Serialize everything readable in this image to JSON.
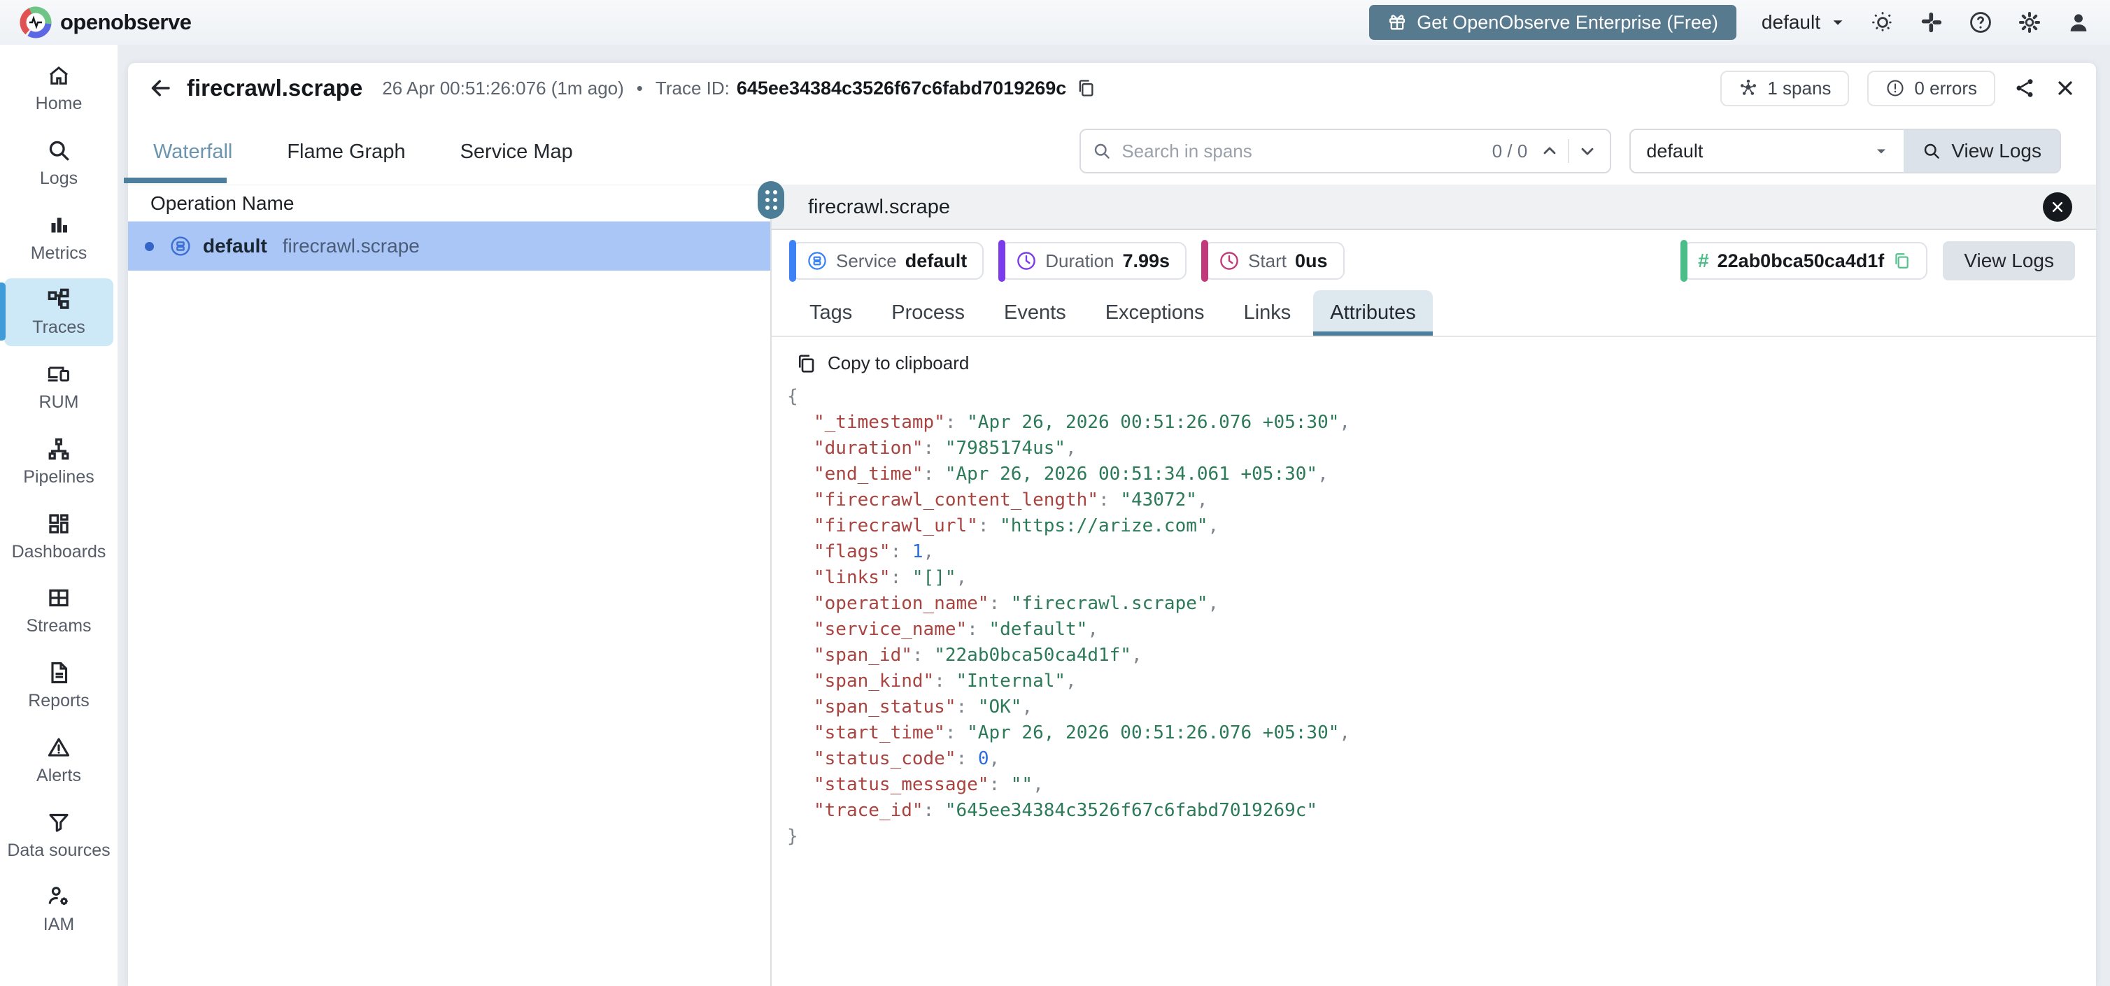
{
  "app": {
    "logo_text": "openobserve",
    "enterprise_button_label": "Get OpenObserve Enterprise (Free)",
    "org_selector_value": "default"
  },
  "colors": {
    "brand_accent": "#3f9cd8",
    "enterprise_button_bg": "#587a8e",
    "active_tab_underline": "#4d7e9c",
    "selected_row_bg": "#a9c6f6",
    "service_accent": "#3b82f6",
    "duration_accent": "#7c3aed",
    "start_accent": "#c2397b",
    "span_id_accent": "#4bbd88",
    "json_key_color": "#a94440",
    "json_string_color": "#2c7a58",
    "json_number_color": "#2c6be0"
  },
  "sidebar": {
    "items": [
      {
        "label": "Home"
      },
      {
        "label": "Logs"
      },
      {
        "label": "Metrics"
      },
      {
        "label": "Traces",
        "active": true
      },
      {
        "label": "RUM"
      },
      {
        "label": "Pipelines"
      },
      {
        "label": "Dashboards"
      },
      {
        "label": "Streams"
      },
      {
        "label": "Reports"
      },
      {
        "label": "Alerts"
      },
      {
        "label": "Data sources"
      },
      {
        "label": "IAM"
      }
    ]
  },
  "trace_header": {
    "title": "firecrawl.scrape",
    "timestamp": "26 Apr 00:51:26:076 (1m ago)",
    "separator": "•",
    "trace_id_label": "Trace ID:",
    "trace_id": "645ee34384c3526f67c6fabd7019269c",
    "spans_count": "1 spans",
    "errors_count": "0 errors"
  },
  "toolbar": {
    "tabs": [
      {
        "label": "Waterfall",
        "active": true
      },
      {
        "label": "Flame Graph"
      },
      {
        "label": "Service Map"
      }
    ],
    "search_placeholder": "Search in spans",
    "match_counter": "0 / 0",
    "stream_selector_value": "default",
    "view_logs_label": "View Logs"
  },
  "span_list": {
    "header": "Operation Name",
    "rows": [
      {
        "service": "default",
        "operation": "firecrawl.scrape",
        "selected": true
      }
    ]
  },
  "span_detail": {
    "title": "firecrawl.scrape",
    "badges": [
      {
        "label": "Service",
        "value": "default",
        "accent": "#3b82f6",
        "icon": "service-icon"
      },
      {
        "label": "Duration",
        "value": "7.99s",
        "accent": "#7c3aed",
        "icon": "clock-icon"
      },
      {
        "label": "Start",
        "value": "0us",
        "accent": "#c2397b",
        "icon": "clock-icon"
      }
    ],
    "span_id": "22ab0bca50ca4d1f",
    "view_logs_label": "View Logs",
    "tabs": [
      {
        "label": "Tags"
      },
      {
        "label": "Process"
      },
      {
        "label": "Events"
      },
      {
        "label": "Exceptions"
      },
      {
        "label": "Links"
      },
      {
        "label": "Attributes",
        "active": true
      }
    ],
    "copy_label": "Copy to clipboard",
    "attributes": [
      {
        "key": "_timestamp",
        "value": "Apr 26, 2026 00:51:26.076 +05:30",
        "type": "string"
      },
      {
        "key": "duration",
        "value": "7985174us",
        "type": "string"
      },
      {
        "key": "end_time",
        "value": "Apr 26, 2026 00:51:34.061 +05:30",
        "type": "string"
      },
      {
        "key": "firecrawl_content_length",
        "value": "43072",
        "type": "string"
      },
      {
        "key": "firecrawl_url",
        "value": "https://arize.com",
        "type": "string"
      },
      {
        "key": "flags",
        "value": 1,
        "type": "number"
      },
      {
        "key": "links",
        "value": "[]",
        "type": "string"
      },
      {
        "key": "operation_name",
        "value": "firecrawl.scrape",
        "type": "string"
      },
      {
        "key": "service_name",
        "value": "default",
        "type": "string"
      },
      {
        "key": "span_id",
        "value": "22ab0bca50ca4d1f",
        "type": "string"
      },
      {
        "key": "span_kind",
        "value": "Internal",
        "type": "string"
      },
      {
        "key": "span_status",
        "value": "OK",
        "type": "string"
      },
      {
        "key": "start_time",
        "value": "Apr 26, 2026 00:51:26.076 +05:30",
        "type": "string"
      },
      {
        "key": "status_code",
        "value": 0,
        "type": "number"
      },
      {
        "key": "status_message",
        "value": "",
        "type": "string"
      },
      {
        "key": "trace_id",
        "value": "645ee34384c3526f67c6fabd7019269c",
        "type": "string"
      }
    ]
  }
}
